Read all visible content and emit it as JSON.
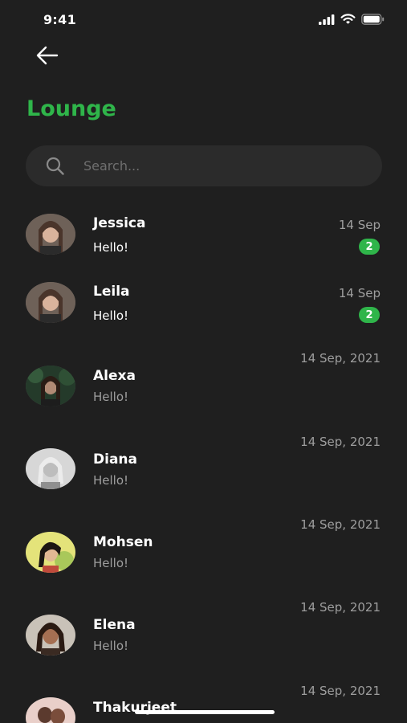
{
  "status_bar": {
    "time": "9:41"
  },
  "header": {
    "title": "Lounge"
  },
  "search": {
    "placeholder": "Search..."
  },
  "colors": {
    "accent": "#2fb54a",
    "background": "#1f1f1f",
    "search_bg": "#2b2b2b",
    "muted": "#9e9e9e"
  },
  "chats": [
    {
      "name": "Jessica",
      "message": "Hello!",
      "date": "14 Sep",
      "unread": "2"
    },
    {
      "name": "Leila",
      "message": "Hello!",
      "date": "14 Sep",
      "unread": "2"
    },
    {
      "name": "Alexa",
      "message": "Hello!",
      "date": "14 Sep, 2021"
    },
    {
      "name": "Diana",
      "message": "Hello!",
      "date": "14 Sep, 2021"
    },
    {
      "name": "Mohsen",
      "message": "Hello!",
      "date": "14 Sep, 2021"
    },
    {
      "name": "Elena",
      "message": "Hello!",
      "date": "14 Sep, 2021"
    },
    {
      "name": "Thakurjeet",
      "message": "",
      "date": "14 Sep, 2021"
    }
  ],
  "icons": {
    "back": "arrow-left-icon",
    "search": "search-icon",
    "signal": "cellular-signal-icon",
    "wifi": "wifi-icon",
    "battery": "battery-icon"
  }
}
